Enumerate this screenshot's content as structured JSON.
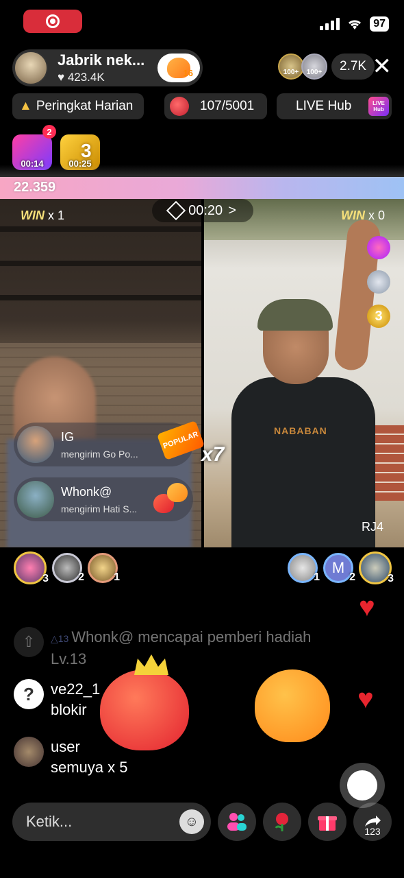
{
  "status_bar": {
    "battery": "97"
  },
  "header": {
    "host_name": "Jabrik nek...",
    "host_likes": "♥ 423.4K",
    "follow_count": "16",
    "viewer_badges": [
      "100+",
      "100+"
    ],
    "viewer_count": "2.7K",
    "close_icon": "✕"
  },
  "pills": {
    "rank_label": "Peringkat Harian",
    "gift_goal": "107/5001",
    "hub_label": "LIVE Hub",
    "hub_badge": "LIVE Hub"
  },
  "boosts": [
    {
      "time": "00:14",
      "icon": "lightning-icon"
    },
    {
      "time": "00:25",
      "icon": "three-icon",
      "number": "3"
    }
  ],
  "notif_count": "2",
  "battle": {
    "score": "22.359",
    "left_win_label": "WIN",
    "left_win_count": "x 1",
    "right_win_label": "WIN",
    "right_win_count": "x 0",
    "timer": "00:20",
    "timer_chevron": ">",
    "combo": "x7",
    "right_label": "RJ4",
    "side_icon_3": "3",
    "shirt_print": "NABABAN"
  },
  "gift_notifications": [
    {
      "name": "IG",
      "action": "mengirim Go Po...",
      "gift_label": "POPULAR"
    },
    {
      "name": "Whonk@",
      "action": "mengirim Hati S..."
    }
  ],
  "supporters_left": [
    {
      "rank": "3"
    },
    {
      "rank": "2"
    },
    {
      "rank": "1"
    }
  ],
  "supporters_right": [
    {
      "rank": "1",
      "initial": ""
    },
    {
      "rank": "2",
      "initial": "M"
    },
    {
      "rank": "3",
      "initial": ""
    }
  ],
  "chat": [
    {
      "badge": "△13",
      "line1": "Whonk@ mencapai pemberi hadiah",
      "line2": "Lv.13"
    },
    {
      "line1": "ve22_1",
      "line2": "blokir"
    },
    {
      "line1": "user",
      "line2": "semuya x 5"
    }
  ],
  "bottom": {
    "input_placeholder": "Ketik...",
    "emoji_icon": "☺",
    "share_count": "123"
  }
}
